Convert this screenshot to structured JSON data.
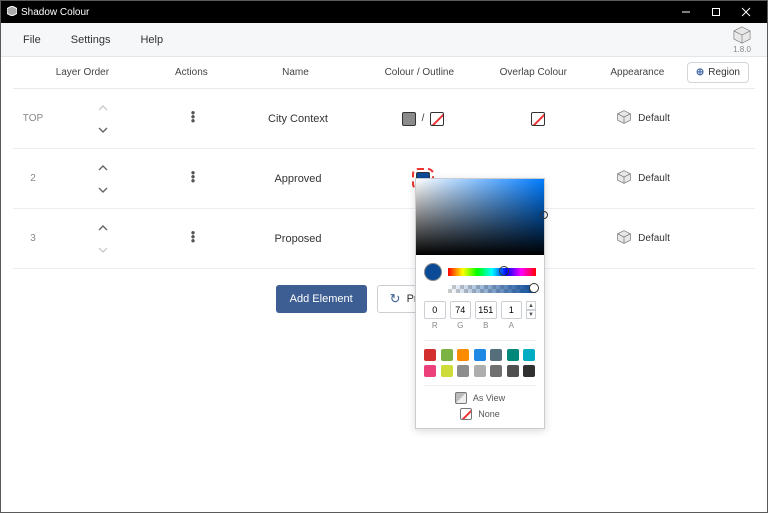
{
  "window": {
    "title": "Shadow Colour"
  },
  "menubar": {
    "file": "File",
    "settings": "Settings",
    "help": "Help",
    "version": "1.8.0"
  },
  "table": {
    "headers": {
      "layer_order": "Layer Order",
      "actions": "Actions",
      "name": "Name",
      "colour_outline": "Colour / Outline",
      "overlap": "Overlap Colour",
      "appearance": "Appearance"
    },
    "region_button": "Region",
    "rows": [
      {
        "index": "TOP",
        "up_disabled": true,
        "down_disabled": false,
        "name": "City Context",
        "colour": "#8b8b8b",
        "colour_selected": false,
        "outline": "none",
        "colour_separator": "/",
        "overlap": "none",
        "appearance": "Default"
      },
      {
        "index": "2",
        "up_disabled": false,
        "down_disabled": false,
        "name": "Approved",
        "colour": "#0a4a97",
        "colour_selected": true,
        "outline": null,
        "colour_separator": "",
        "overlap": null,
        "appearance": "Default"
      },
      {
        "index": "3",
        "up_disabled": false,
        "down_disabled": true,
        "name": "Proposed",
        "colour": "#8b8b8b",
        "colour_selected": false,
        "outline": null,
        "colour_separator": "",
        "overlap": null,
        "appearance": "Default"
      }
    ]
  },
  "buttons": {
    "add_element": "Add Element",
    "preview_image": "Preview Image"
  },
  "color_picker": {
    "r": "0",
    "g": "74",
    "b": "151",
    "a": "1",
    "labels": {
      "r": "R",
      "g": "G",
      "b": "B",
      "a": "A"
    },
    "preview_hex": "#0a4a97",
    "swatches": [
      "#d32f2f",
      "#7cb342",
      "#fb8c00",
      "#1e88e5",
      "#546e7a",
      "#00897b",
      "#00acc1",
      "#ec407a",
      "#cddc39",
      "#8d8d8d",
      "#aeaeae",
      "#707070",
      "#505050",
      "#303030"
    ],
    "footer": {
      "as_view": "As View",
      "none": "None"
    }
  }
}
